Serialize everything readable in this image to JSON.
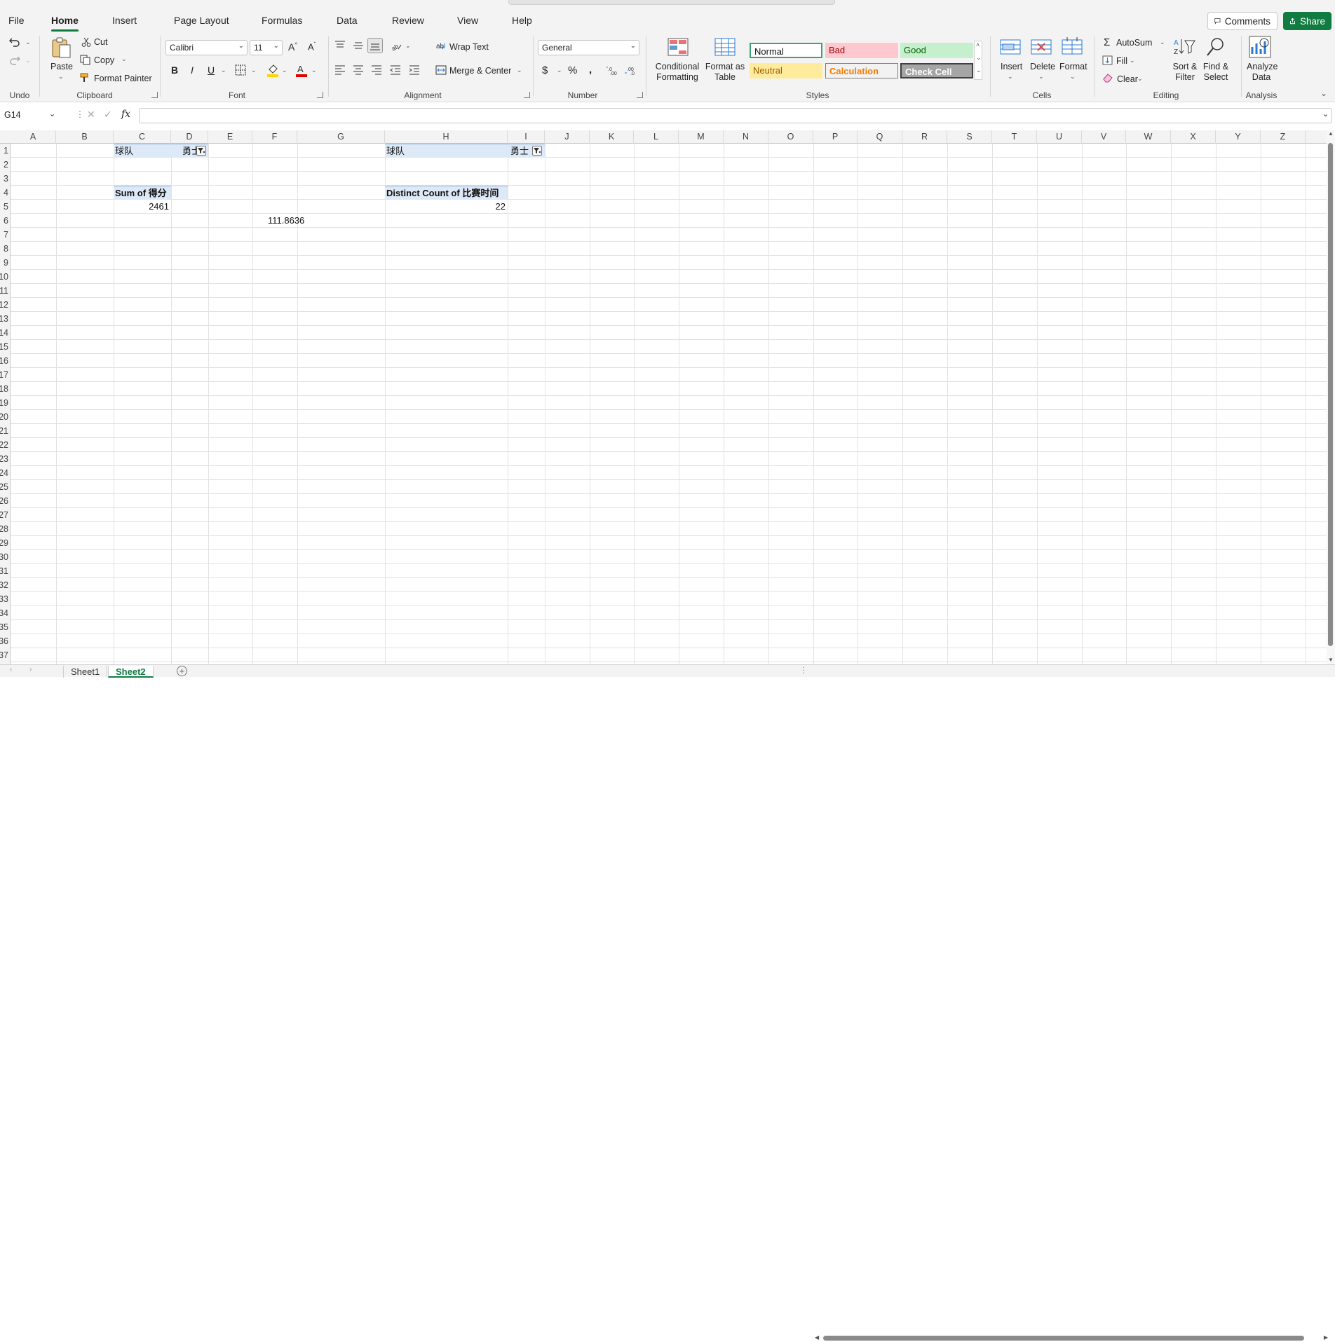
{
  "menu": {
    "tabs": [
      "File",
      "Home",
      "Insert",
      "Page Layout",
      "Formulas",
      "Data",
      "Review",
      "View",
      "Help"
    ],
    "active_tab": "Home",
    "comments_label": "Comments",
    "share_label": "Share"
  },
  "ribbon": {
    "clipboard": {
      "paste": "Paste",
      "cut": "Cut",
      "copy": "Copy",
      "format_painter": "Format Painter",
      "group": "Clipboard"
    },
    "undo_group": "Undo",
    "font": {
      "name": "Calibri",
      "size": "11",
      "group": "Font",
      "bold": "B",
      "italic": "I",
      "underline": "U"
    },
    "alignment": {
      "wrap_text": "Wrap Text",
      "merge_center": "Merge & Center",
      "group": "Alignment"
    },
    "number": {
      "format": "General",
      "group": "Number"
    },
    "styles": {
      "conditional_formatting": "Conditional Formatting",
      "format_as_table": "Format as Table",
      "normal": "Normal",
      "bad": "Bad",
      "good": "Good",
      "neutral": "Neutral",
      "calculation": "Calculation",
      "check_cell": "Check Cell",
      "group": "Styles"
    },
    "cells": {
      "insert": "Insert",
      "delete": "Delete",
      "format": "Format",
      "group": "Cells"
    },
    "editing": {
      "autosum": "AutoSum",
      "fill": "Fill",
      "clear": "Clear",
      "sort_filter": "Sort & Filter",
      "find_select": "Find & Select",
      "group": "Editing"
    },
    "analysis": {
      "analyze_data": "Analyze Data",
      "group": "Analysis"
    }
  },
  "formula_bar": {
    "name_box": "G14",
    "fx": "fx",
    "formula": ""
  },
  "grid": {
    "columns": [
      "A",
      "B",
      "C",
      "D",
      "E",
      "F",
      "G",
      "H",
      "I",
      "J",
      "K",
      "L",
      "M",
      "N",
      "O",
      "P",
      "Q",
      "R",
      "S",
      "T",
      "U",
      "V",
      "W",
      "X",
      "Y",
      "Z"
    ],
    "rows": [
      "1",
      "2",
      "3",
      "4",
      "5",
      "6",
      "7",
      "8",
      "9",
      "10",
      "11",
      "12",
      "13",
      "14",
      "15",
      "16",
      "17",
      "18",
      "19",
      "20",
      "21",
      "22",
      "23",
      "24",
      "25",
      "26",
      "27",
      "28",
      "29",
      "30",
      "31",
      "32",
      "33",
      "34",
      "35",
      "36",
      "37"
    ],
    "cells": {
      "C1": "球队",
      "D1": "勇士",
      "C3": "Sum of 得分",
      "C4": "2461",
      "F6": "111.8636",
      "H1": "球队",
      "I1": "勇士",
      "H3": "Distinct Count of 比赛时间",
      "H4": "22"
    }
  },
  "sheets": {
    "tabs": [
      "Sheet1",
      "Sheet2"
    ],
    "active": "Sheet2"
  }
}
